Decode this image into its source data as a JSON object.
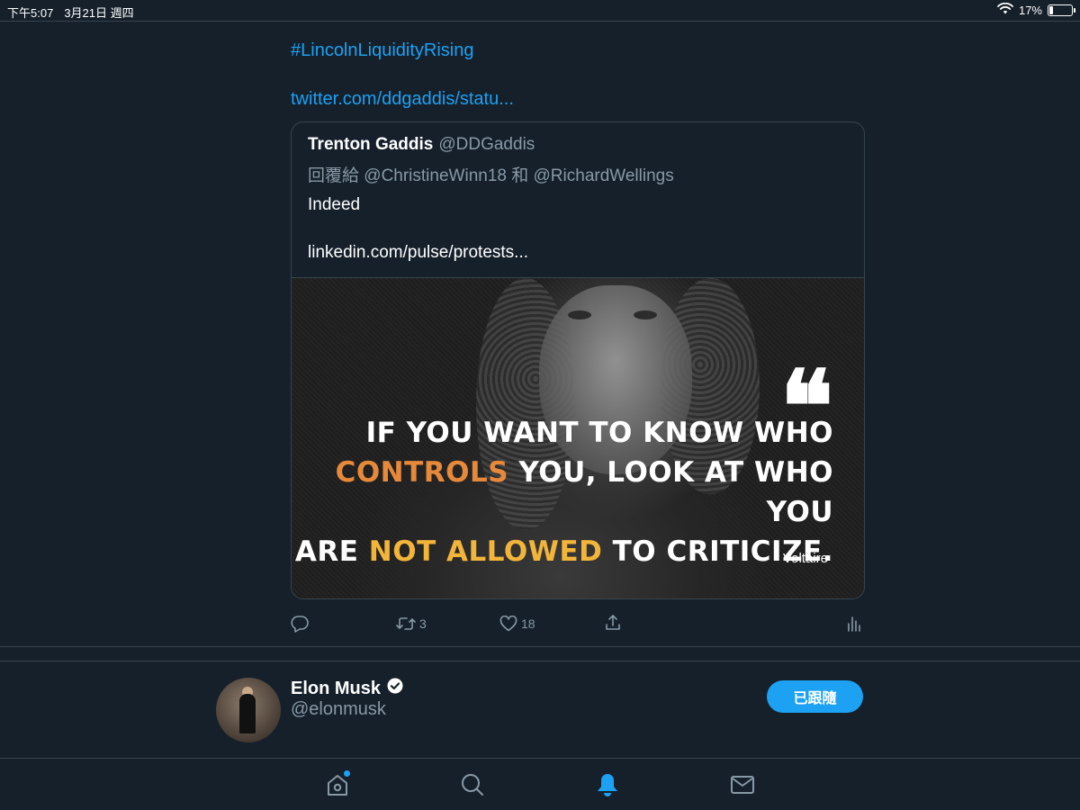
{
  "status_bar": {
    "time": "下午5:07",
    "date": "3月21日 週四",
    "battery_percent": "17%",
    "battery_level": 0.17,
    "wifi_icon": "wifi-icon"
  },
  "tweet": {
    "hashtag": "#LincolnLiquidityRising",
    "link": "twitter.com/ddgaddis/statu...",
    "quoted": {
      "name": "Trenton Gaddis",
      "handle": "@DDGaddis",
      "reply_to": "回覆給 @ChristineWinn18 和 @RichardWellings",
      "text": "Indeed",
      "link": "linkedin.com/pulse/protests...",
      "image": {
        "quote_mark": "❝",
        "line1": "If you want to know who",
        "line2_highlight": "controls",
        "line2_rest": " you, look at who you",
        "line3_start": "are ",
        "line3_highlight": "not allowed",
        "line3_rest": " to criticize.",
        "attribution": "- Voltaire",
        "highlight_color_1": "#e7893a",
        "highlight_color_2": "#f2b53a"
      }
    },
    "actions": {
      "reply_count": "",
      "retweet_count": "3",
      "like_count": "18"
    }
  },
  "profile": {
    "name": "Elon Musk",
    "handle": "@elonmusk",
    "verified": true,
    "follow_label": "已跟隨"
  },
  "bottom_nav": {
    "items": [
      "home-icon",
      "search-icon",
      "notifications-icon",
      "messages-icon"
    ],
    "active": "notifications-icon"
  },
  "colors": {
    "background": "#15202b",
    "accent": "#1da1f2",
    "secondary_text": "#8899a6",
    "border": "#38444d"
  }
}
